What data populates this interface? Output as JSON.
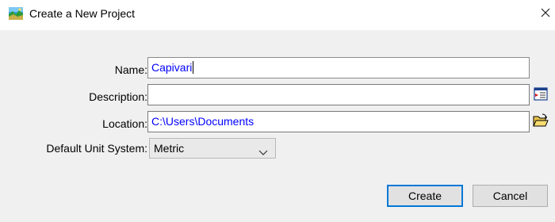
{
  "window": {
    "title": "Create a New Project",
    "icon": "landscape-app-icon",
    "close_icon": "close-icon"
  },
  "form": {
    "name": {
      "label": "Name:",
      "value": "Capivari"
    },
    "description": {
      "label": "Description:",
      "value": "",
      "button_icon": "text-editor-icon"
    },
    "location": {
      "label": "Location:",
      "value": "C:\\Users\\Documents",
      "button_icon": "open-folder-icon"
    },
    "unit_system": {
      "label": "Default Unit System:",
      "selected": "Metric"
    }
  },
  "buttons": {
    "create": "Create",
    "cancel": "Cancel"
  },
  "colors": {
    "field_text": "#0000ff",
    "dialog_background": "#f0f0f0",
    "default_button_border": "#0078d7"
  }
}
